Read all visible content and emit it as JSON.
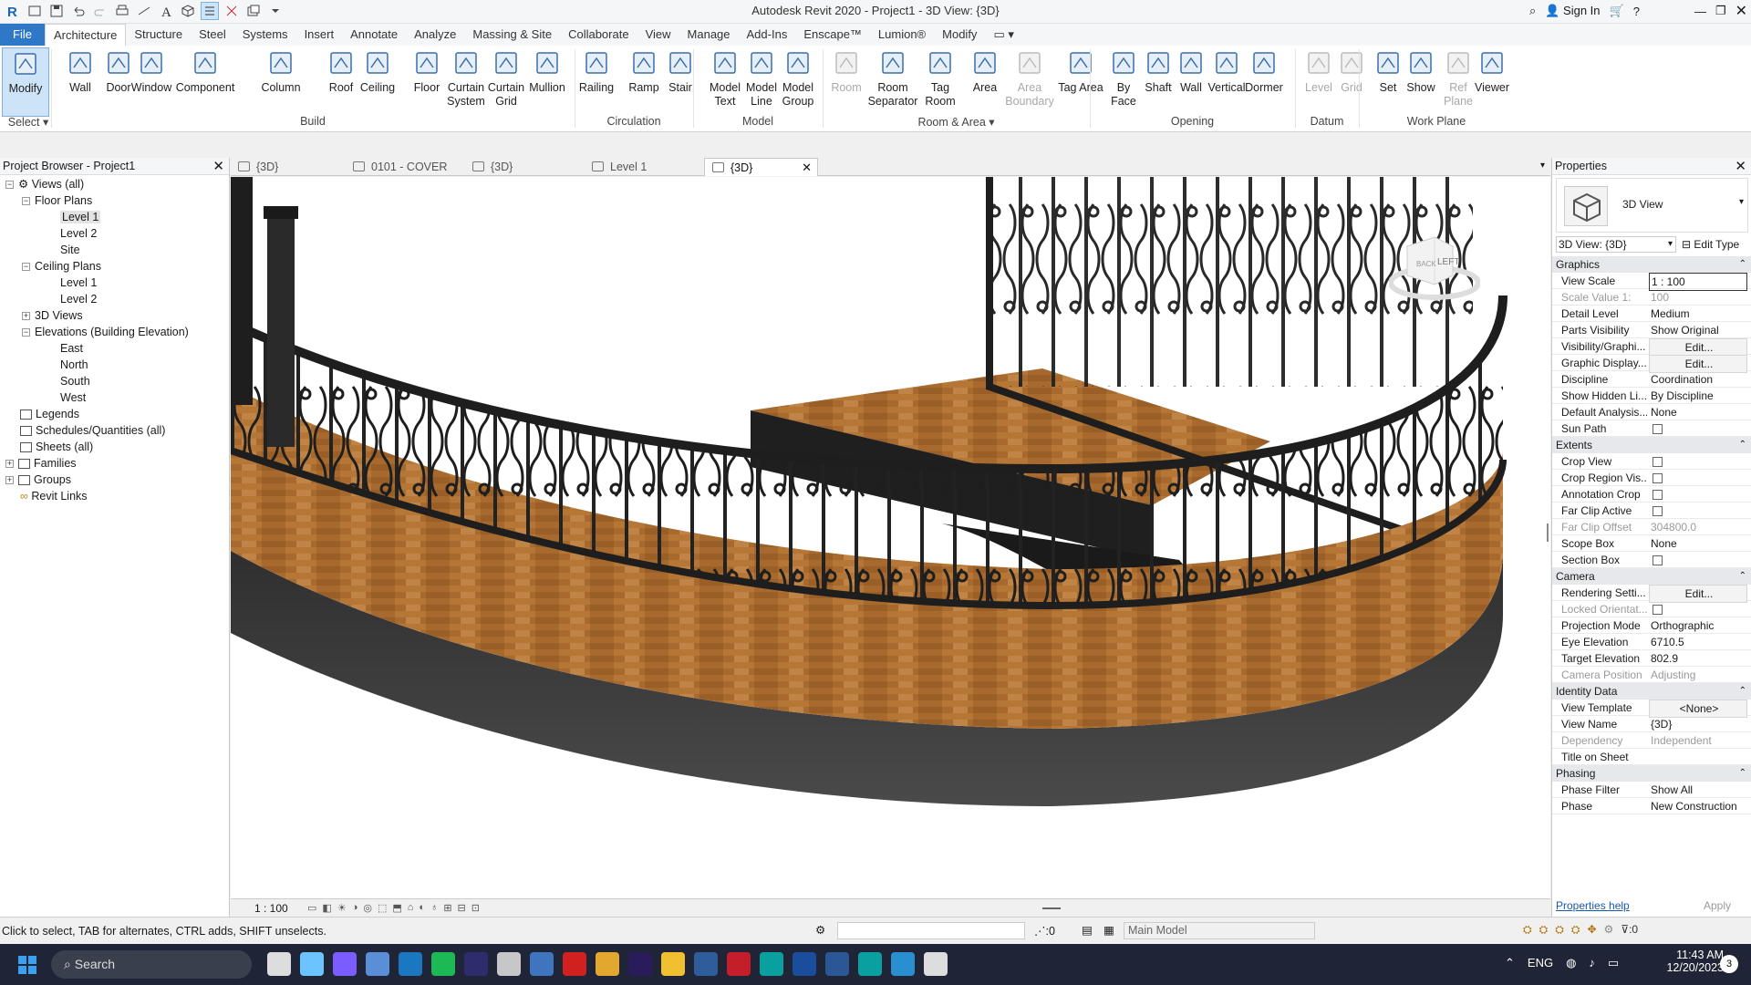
{
  "app": {
    "title": "Autodesk Revit 2020 - Project1 - 3D View: {3D}",
    "sign_in": "Sign In"
  },
  "menu": [
    "File",
    "Architecture",
    "Structure",
    "Steel",
    "Systems",
    "Insert",
    "Annotate",
    "Analyze",
    "Massing & Site",
    "Collaborate",
    "View",
    "Manage",
    "Add-Ins",
    "Enscape™",
    "Lumion®",
    "Modify"
  ],
  "ribbon": {
    "buttons": [
      {
        "id": "modify",
        "label": "Modify",
        "icon": "cursor-icon"
      },
      {
        "id": "wall",
        "label": "Wall",
        "icon": "wall-icon"
      },
      {
        "id": "door",
        "label": "Door",
        "icon": "door-icon"
      },
      {
        "id": "window",
        "label": "Window",
        "icon": "window-icon"
      },
      {
        "id": "component",
        "label": "Component",
        "icon": "component-icon"
      },
      {
        "id": "column",
        "label": "Column",
        "icon": "column-icon"
      },
      {
        "id": "roof",
        "label": "Roof",
        "icon": "roof-icon"
      },
      {
        "id": "ceiling",
        "label": "Ceiling",
        "icon": "ceiling-icon"
      },
      {
        "id": "floor",
        "label": "Floor",
        "icon": "floor-icon"
      },
      {
        "id": "curtain_system",
        "label": "Curtain System",
        "icon": "curtain-system-icon"
      },
      {
        "id": "curtain_grid",
        "label": "Curtain Grid",
        "icon": "curtain-grid-icon"
      },
      {
        "id": "mullion",
        "label": "Mullion",
        "icon": "mullion-icon"
      },
      {
        "id": "railing",
        "label": "Railing",
        "icon": "railing-icon"
      },
      {
        "id": "ramp",
        "label": "Ramp",
        "icon": "ramp-icon"
      },
      {
        "id": "stair",
        "label": "Stair",
        "icon": "stair-icon"
      },
      {
        "id": "model_text",
        "label": "Model Text",
        "icon": "model-text-icon"
      },
      {
        "id": "model_line",
        "label": "Model Line",
        "icon": "model-line-icon"
      },
      {
        "id": "model_group",
        "label": "Model Group",
        "icon": "model-group-icon"
      },
      {
        "id": "room",
        "label": "Room",
        "icon": "room-icon"
      },
      {
        "id": "room_separator",
        "label": "Room Separator",
        "icon": "room-separator-icon"
      },
      {
        "id": "tag_room",
        "label": "Tag Room",
        "icon": "tag-room-icon"
      },
      {
        "id": "area",
        "label": "Area",
        "icon": "area-icon"
      },
      {
        "id": "area_boundary",
        "label": "Area Boundary",
        "icon": "area-boundary-icon"
      },
      {
        "id": "tag_area",
        "label": "Tag Area",
        "icon": "tag-area-icon"
      },
      {
        "id": "by_face",
        "label": "By Face",
        "icon": "by-face-icon"
      },
      {
        "id": "shaft",
        "label": "Shaft",
        "icon": "shaft-icon"
      },
      {
        "id": "opening_wall",
        "label": "Wall",
        "icon": "wall-opening-icon"
      },
      {
        "id": "vertical",
        "label": "Vertical",
        "icon": "vertical-opening-icon"
      },
      {
        "id": "dormer",
        "label": "Dormer",
        "icon": "dormer-icon"
      },
      {
        "id": "level",
        "label": "Level",
        "icon": "level-icon"
      },
      {
        "id": "grid",
        "label": "Grid",
        "icon": "grid-icon"
      },
      {
        "id": "set",
        "label": "Set",
        "icon": "set-workplane-icon"
      },
      {
        "id": "show",
        "label": "Show",
        "icon": "show-workplane-icon"
      },
      {
        "id": "ref_plane",
        "label": "Ref Plane",
        "icon": "ref-plane-icon"
      },
      {
        "id": "viewer",
        "label": "Viewer",
        "icon": "viewer-icon"
      }
    ],
    "groups": [
      "Select",
      "Build",
      "Circulation",
      "Model",
      "Room & Area",
      "Opening",
      "Datum",
      "Work Plane"
    ]
  },
  "browser": {
    "title": "Project Browser - Project1",
    "items": [
      "Views (all)",
      "Floor Plans",
      "Level 1",
      "Level 2",
      "Site",
      "Ceiling Plans",
      "Level 1",
      "Level 2",
      "3D Views",
      "Elevations (Building Elevation)",
      "East",
      "North",
      "South",
      "West",
      "Legends",
      "Schedules/Quantities (all)",
      "Sheets (all)",
      "Families",
      "Groups",
      "Revit Links"
    ]
  },
  "view_tabs": [
    "{3D}",
    "0101 - COVER",
    "{3D}",
    "Level 1",
    "{3D}"
  ],
  "viewcube": {
    "face_left": "LEFT",
    "face_back": "BACK"
  },
  "view_bar": {
    "scale": "1 : 100"
  },
  "properties": {
    "title": "Properties",
    "type_name": "3D View",
    "selector": "3D View: {3D}",
    "edit_type": "Edit Type",
    "sections": {
      "graphics": "Graphics",
      "extents": "Extents",
      "camera": "Camera",
      "identity": "Identity Data",
      "phasing": "Phasing"
    },
    "rows": [
      [
        "View Scale",
        "1 : 100"
      ],
      [
        "Scale Value    1:",
        "100"
      ],
      [
        "Detail Level",
        "Medium"
      ],
      [
        "Parts Visibility",
        "Show Original"
      ],
      [
        "Visibility/Graphi...",
        "Edit..."
      ],
      [
        "Graphic Display...",
        "Edit..."
      ],
      [
        "Discipline",
        "Coordination"
      ],
      [
        "Show Hidden Li...",
        "By Discipline"
      ],
      [
        "Default Analysis...",
        "None"
      ],
      [
        "Sun Path",
        ""
      ],
      [
        "Crop View",
        ""
      ],
      [
        "Crop Region Vis...",
        ""
      ],
      [
        "Annotation Crop",
        ""
      ],
      [
        "Far Clip Active",
        ""
      ],
      [
        "Far Clip Offset",
        "304800.0"
      ],
      [
        "Scope Box",
        "None"
      ],
      [
        "Section Box",
        ""
      ],
      [
        "Rendering Setti...",
        "Edit..."
      ],
      [
        "Locked Orientat...",
        ""
      ],
      [
        "Projection Mode",
        "Orthographic"
      ],
      [
        "Eye Elevation",
        "6710.5"
      ],
      [
        "Target Elevation",
        "802.9"
      ],
      [
        "Camera Position",
        "Adjusting"
      ],
      [
        "View Template",
        "<None>"
      ],
      [
        "View Name",
        "{3D}"
      ],
      [
        "Dependency",
        "Independent"
      ],
      [
        "Title on Sheet",
        ""
      ],
      [
        "Phase Filter",
        "Show All"
      ],
      [
        "Phase",
        "New Construction"
      ]
    ],
    "help": "Properties help",
    "apply": "Apply"
  },
  "status": {
    "hint": "Click to select, TAB for alternates, CTRL adds, SHIFT unselects.",
    "zero": ":0",
    "workset": "Main Model",
    "filter": ":0"
  },
  "taskbar": {
    "search": "Search",
    "lang": "ENG",
    "time": "11:43 AM",
    "date": "12/20/2023",
    "badge": "3"
  },
  "colors": {
    "accent": "#2e78c7",
    "wood": "#a8692e",
    "rail": "#1e1e1e"
  }
}
